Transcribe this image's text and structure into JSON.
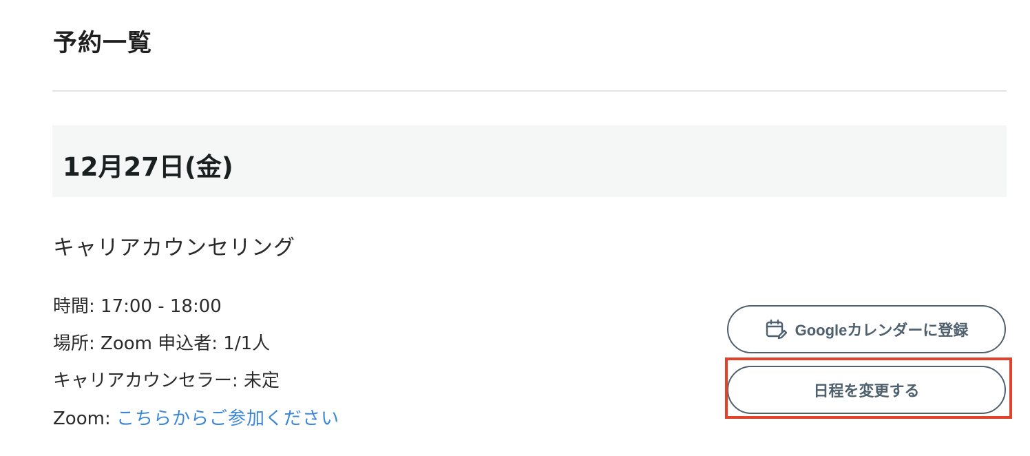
{
  "page": {
    "title": "予約一覧"
  },
  "reservation": {
    "date": "12月27日(金)",
    "event_title": "キャリアカウンセリング",
    "time_label": "時間:",
    "time_value": "17:00 - 18:00",
    "place_label": "場所:",
    "place_value": "Zoom",
    "applicants_label": "申込者:",
    "applicants_value": "1/1人",
    "counselor_label": "キャリアカウンセラー:",
    "counselor_value": "未定",
    "zoom_label": "Zoom:",
    "zoom_link_text": "こちらからご参加ください"
  },
  "actions": {
    "google_calendar_label": "Googleカレンダーに登録",
    "google_calendar_icon": "calendar-edit-icon",
    "reschedule_label": "日程を変更する"
  },
  "colors": {
    "link": "#3b86d6",
    "button_border": "#4e5f6e",
    "highlight": "#e2412b",
    "date_header_bg": "#f5f7f6"
  }
}
